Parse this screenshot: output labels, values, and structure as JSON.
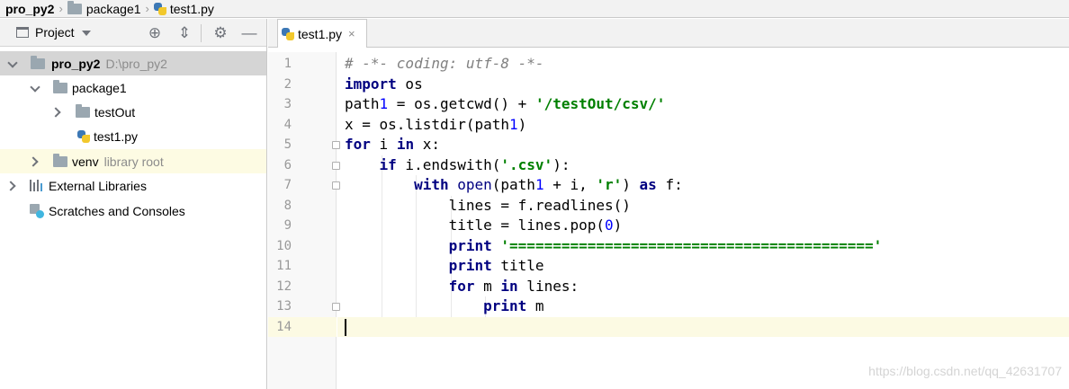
{
  "breadcrumb": [
    {
      "label": "pro_py2",
      "icon": "none",
      "bold": true
    },
    {
      "label": "package1",
      "icon": "folder-icon"
    },
    {
      "label": "test1.py",
      "icon": "python-file-icon"
    }
  ],
  "project_panel": {
    "title": "Project",
    "toolbar_icons": [
      "target-icon",
      "collapse-icon",
      "gear-icon",
      "minimize-icon"
    ]
  },
  "tree": [
    {
      "label": "pro_py2",
      "hint": "D:\\pro_py2",
      "bold": true,
      "icon": "folder-icon"
    },
    {
      "label": "package1",
      "icon": "folder-icon"
    },
    {
      "label": "testOut",
      "icon": "folder-icon"
    },
    {
      "label": "test1.py",
      "icon": "python-file-icon"
    },
    {
      "label": "venv",
      "hint": "library root",
      "icon": "folder-icon"
    },
    {
      "label": "External Libraries",
      "icon": "library-icon"
    },
    {
      "label": "Scratches and Consoles",
      "icon": "scratch-icon"
    }
  ],
  "editor_tab": {
    "label": "test1.py",
    "close": "×"
  },
  "line_numbers": [
    "1",
    "2",
    "3",
    "4",
    "5",
    "6",
    "7",
    "8",
    "9",
    "10",
    "11",
    "12",
    "13",
    "14"
  ],
  "code": [
    "# -*- coding: utf-8 -*-",
    "import os",
    "path1 = os.getcwd() + '/testOut/csv/'",
    "x = os.listdir(path1)",
    "for i in x:",
    "    if i.endswith('.csv'):",
    "        with open(path1 + i, 'r') as f:",
    "            lines = f.readlines()",
    "            title = lines.pop(0)",
    "            print '=========================================='",
    "            print title",
    "            for m in lines:",
    "                print m",
    ""
  ],
  "current_line": "14",
  "watermark": "https://blog.csdn.net/qq_42631707",
  "colors": {
    "keyword": "#000080",
    "string": "#008000",
    "comment": "#808080",
    "number": "#0000ff"
  }
}
